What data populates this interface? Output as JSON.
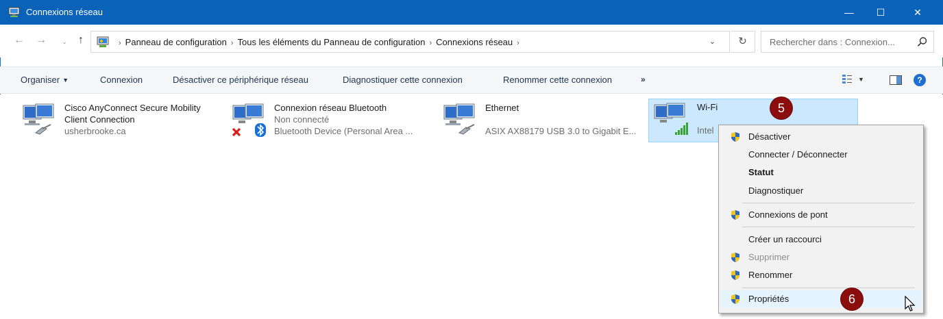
{
  "window": {
    "title": "Connexions réseau",
    "controls": {
      "minimize": "—",
      "maximize": "☐",
      "close": "✕"
    }
  },
  "address": {
    "back": "←",
    "forward": "→",
    "recent": "⌄",
    "up": "↑",
    "crumbs": [
      "Panneau de configuration",
      "Tous les éléments du Panneau de configuration",
      "Connexions réseau"
    ],
    "separator": "›",
    "dropdown": "⌄",
    "refresh": "↻",
    "search_placeholder": "Rechercher dans : Connexion..."
  },
  "toolbar": {
    "organiser": "Organiser",
    "organiser_caret": "▼",
    "connexion": "Connexion",
    "desactiver": "Désactiver ce périphérique réseau",
    "diagnostiquer": "Diagnostiquer cette connexion",
    "renommer": "Renommer cette connexion",
    "more": "»",
    "view_caret": "▼",
    "help": "?"
  },
  "connections": [
    {
      "name": "Cisco AnyConnect Secure Mobility",
      "name2": "Client Connection",
      "sub": "usherbrooke.ca"
    },
    {
      "name": "Connexion réseau Bluetooth",
      "status": "Non connecté",
      "sub": "Bluetooth Device (Personal Area ..."
    },
    {
      "name": "Ethernet",
      "sub": "ASIX AX88179 USB 3.0 to Gigabit E..."
    },
    {
      "name": "Wi-Fi",
      "sub": "Intel"
    }
  ],
  "badges": {
    "step5": "5",
    "step6": "6"
  },
  "context_menu": [
    {
      "label": "Désactiver",
      "shield": true
    },
    {
      "label": "Connecter / Déconnecter",
      "shield": false
    },
    {
      "label": "Statut",
      "shield": false,
      "bold": true
    },
    {
      "label": "Diagnostiquer",
      "shield": false
    },
    {
      "label": "Connexions de pont",
      "shield": true
    },
    {
      "label": "Créer un raccourci",
      "shield": false
    },
    {
      "label": "Supprimer",
      "shield": true,
      "disabled": true
    },
    {
      "label": "Renommer",
      "shield": true
    },
    {
      "label": "Propriétés",
      "shield": true,
      "hover": true
    }
  ],
  "colors": {
    "titlebar": "#0a63b8",
    "selection": "#cce8ff",
    "badge": "#8b0d0d",
    "shield_blue": "#2b67c4",
    "shield_yellow": "#f3c614"
  }
}
